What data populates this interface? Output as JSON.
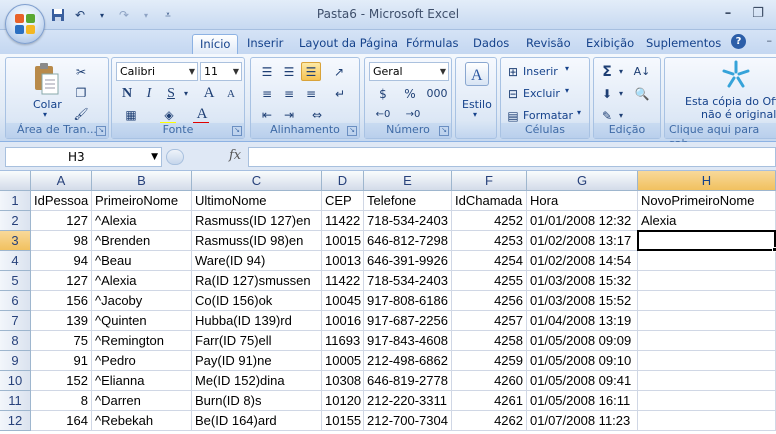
{
  "window": {
    "title": "Pasta6 - Microsoft Excel"
  },
  "qat": {
    "icons": [
      "save-icon",
      "undo-icon",
      "redo-icon",
      "customize-icon"
    ]
  },
  "tabs": [
    "Início",
    "Inserir",
    "Layout da Página",
    "Fórmulas",
    "Dados",
    "Revisão",
    "Exibição",
    "Suplementos"
  ],
  "ribbon": {
    "clipboard": {
      "label": "Área de Tran...",
      "paste_label": "Colar"
    },
    "font": {
      "label": "Fonte",
      "font_name": "Calibri",
      "font_size": "11",
      "bold": "N",
      "italic": "I",
      "underline": "S",
      "grow": "A",
      "shrink": "A",
      "font_color": "A"
    },
    "alignment": {
      "label": "Alinhamento"
    },
    "number": {
      "label": "Número",
      "format": "Geral",
      "percent": "%",
      "thousands": "000"
    },
    "styles": {
      "label": "Estilo"
    },
    "cells": {
      "label": "Células",
      "insert": "Inserir",
      "delete": "Excluir",
      "format": "Formatar"
    },
    "editing": {
      "label": "Edição"
    },
    "promo": {
      "line1": "Esta cópia do Offi",
      "line2": "não é original",
      "label": "Clique aqui para sab"
    }
  },
  "formula_bar": {
    "name_box": "H3",
    "fx": "fx",
    "value": ""
  },
  "sheet": {
    "columns": [
      "A",
      "B",
      "C",
      "D",
      "E",
      "F",
      "G",
      "H"
    ],
    "selected_column": "H",
    "selected_row": "3",
    "rows": [
      {
        "n": "1",
        "cells": [
          "IdPessoa",
          "PrimeiroNome",
          "UltimoNome",
          "CEP",
          "Telefone",
          "IdChamada",
          "Hora",
          "NovoPrimeiroNome"
        ]
      },
      {
        "n": "2",
        "cells": [
          "127",
          "^Alexia",
          "Rasmuss(ID 127)en",
          "11422",
          "718-534-2403",
          "4252",
          "01/01/2008 12:32",
          "Alexia"
        ]
      },
      {
        "n": "3",
        "cells": [
          "98",
          "^Brenden",
          "Rasmuss(ID 98)en",
          "10015",
          "646-812-7298",
          "4253",
          "01/02/2008 13:17",
          ""
        ]
      },
      {
        "n": "4",
        "cells": [
          "94",
          "^Beau",
          "Ware(ID 94)",
          "10013",
          "646-391-9926",
          "4254",
          "01/02/2008 14:54",
          ""
        ]
      },
      {
        "n": "5",
        "cells": [
          "127",
          "^Alexia",
          "Ra(ID 127)smussen",
          "11422",
          "718-534-2403",
          "4255",
          "01/03/2008 15:32",
          ""
        ]
      },
      {
        "n": "6",
        "cells": [
          "156",
          "^Jacoby",
          "Co(ID 156)ok",
          "10045",
          "917-808-6186",
          "4256",
          "01/03/2008 15:52",
          ""
        ]
      },
      {
        "n": "7",
        "cells": [
          "139",
          "^Quinten",
          "Hubba(ID 139)rd",
          "10016",
          "917-687-2256",
          "4257",
          "01/04/2008 13:19",
          ""
        ]
      },
      {
        "n": "8",
        "cells": [
          "75",
          "^Remington",
          "Farr(ID 75)ell",
          "11693",
          "917-843-4608",
          "4258",
          "01/05/2008 09:09",
          ""
        ]
      },
      {
        "n": "9",
        "cells": [
          "91",
          "^Pedro",
          "Pay(ID 91)ne",
          "10005",
          "212-498-6862",
          "4259",
          "01/05/2008 09:10",
          ""
        ]
      },
      {
        "n": "10",
        "cells": [
          "152",
          "^Elianna",
          "Me(ID 152)dina",
          "10308",
          "646-819-2778",
          "4260",
          "01/05/2008 09:41",
          ""
        ]
      },
      {
        "n": "11",
        "cells": [
          "8",
          "^Darren",
          "Burn(ID 8)s",
          "10120",
          "212-220-3311",
          "4261",
          "01/05/2008 16:11",
          ""
        ]
      },
      {
        "n": "12",
        "cells": [
          "164",
          "^Rebekah",
          "Be(ID 164)ard",
          "10155",
          "212-700-7304",
          "4262",
          "01/07/2008 11:23",
          ""
        ]
      }
    ]
  }
}
